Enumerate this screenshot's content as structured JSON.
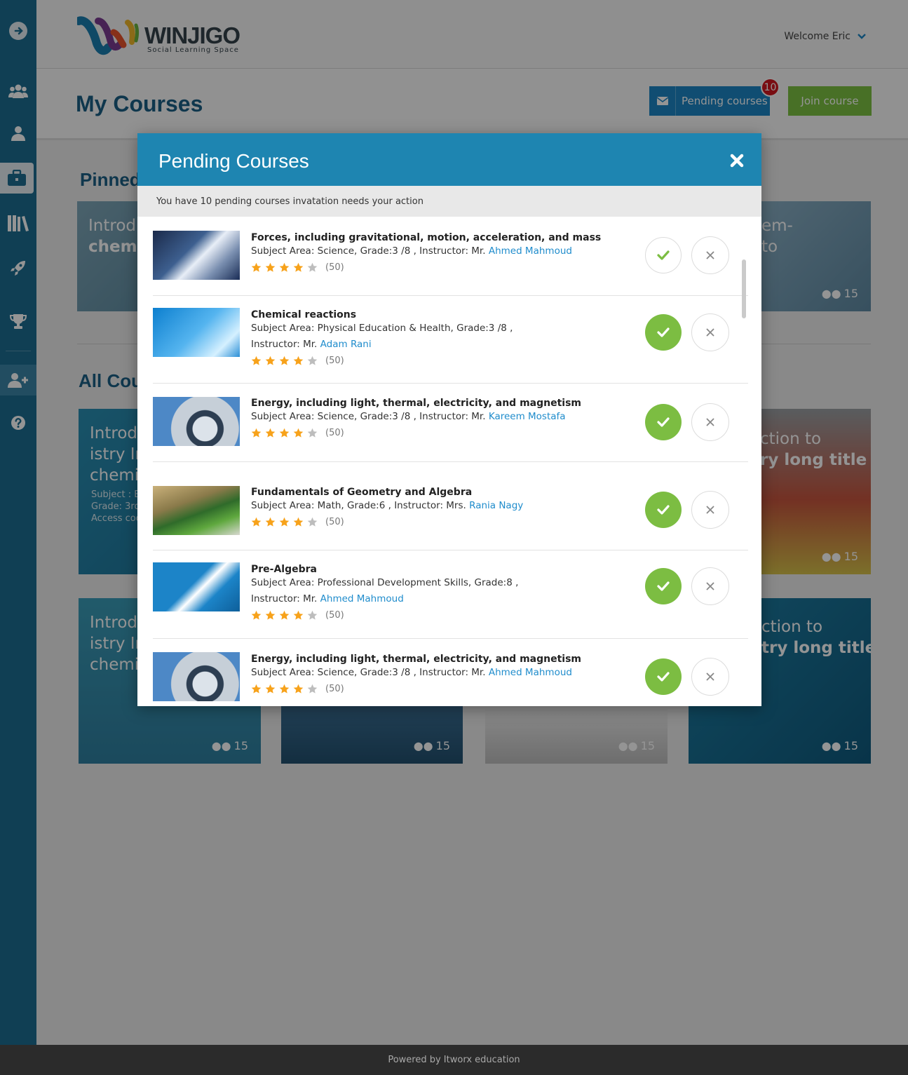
{
  "app": {
    "logo_name": "WINJIGO",
    "logo_tagline": "Social Learning Space",
    "welcome": "Welcome Eric"
  },
  "page": {
    "title": "My Courses",
    "pending_button": "Pending courses",
    "pending_count": "10",
    "join_button": "Join course",
    "section_pinned": "Pinned",
    "section_all": "All Cou"
  },
  "background_cards": [
    {
      "title_1": "Introd",
      "title_2": "chemi",
      "count": ""
    },
    {
      "title_1": "em-",
      "title_2": "to",
      "count": "15"
    },
    {
      "title_1": "Introd",
      "title_2": "istry In",
      "title_3": "chemis",
      "meta_1": "Subject : E",
      "meta_2": "Grade: 3rd",
      "meta_3": "Access cod",
      "count": ""
    },
    {
      "title_1": "ction to",
      "title_2": "ry long title",
      "count": "15"
    },
    {
      "title_1": "Introd",
      "title_2": "istry In",
      "title_3": "chemis",
      "count": "15"
    },
    {
      "count": "15"
    },
    {
      "count": "15"
    },
    {
      "title_1": "ction to",
      "title_2": "try long title",
      "count": "15"
    }
  ],
  "modal": {
    "title": "Pending Courses",
    "subtitle": "You have 10 pending courses invatation needs your action",
    "courses": [
      {
        "title": "Forces, including gravitational, motion, acceleration, and mass",
        "meta": "Subject Area: Science, Grade:3 /8 , Instructor: Mr.",
        "meta_2": "",
        "instructor": "Ahmed Mahmoud",
        "rating_count": "(50)",
        "rating": 4,
        "accepted": false
      },
      {
        "title": "Chemical reactions",
        "meta": "Subject Area: Physical Education & Health, Grade:3 /8 ,",
        "meta_2": "Instructor: Mr.",
        "instructor": "Adam Rani",
        "rating_count": "(50)",
        "rating": 4,
        "accepted": true
      },
      {
        "title": "Energy, including light, thermal, electricity, and magnetism",
        "meta": "Subject Area: Science, Grade:3 /8 , Instructor: Mr.",
        "meta_2": "",
        "instructor": "Kareem Mostafa",
        "rating_count": "(50)",
        "rating": 4,
        "accepted": true
      },
      {
        "title": "Fundamentals of Geometry and Algebra",
        "meta": "Subject Area: Math, Grade:6 , Instructor: Mrs.",
        "meta_2": "",
        "instructor": "Rania Nagy",
        "rating_count": "(50)",
        "rating": 4,
        "accepted": true
      },
      {
        "title": "Pre-Algebra",
        "meta": "Subject Area: Professional Development Skills, Grade:8 ,",
        "meta_2": "Instructor: Mr.",
        "instructor": "Ahmed Mahmoud",
        "rating_count": "(50)",
        "rating": 4,
        "accepted": true
      },
      {
        "title": "Energy, including light, thermal, electricity, and magnetism",
        "meta": "Subject Area: Science, Grade:3 /8 , Instructor: Mr.",
        "meta_2": "",
        "instructor": "Ahmed Mahmoud",
        "rating_count": "(50)",
        "rating": 4,
        "accepted": true
      }
    ]
  },
  "footer": {
    "text": "Powered by Itworx education"
  },
  "colors": {
    "sidebar": "#1c6d91",
    "header_blue": "#1e85b1",
    "accept_green": "#7cbd42",
    "link_blue": "#1f8ccc",
    "badge_red": "#d0181f",
    "star_orange": "#f7a21b"
  },
  "sidebar_icons": [
    "expand-icon",
    "groups-icon",
    "profile-icon",
    "courses-icon",
    "library-icon",
    "rocket-icon",
    "trophy-icon",
    "add-user-icon",
    "help-icon"
  ]
}
